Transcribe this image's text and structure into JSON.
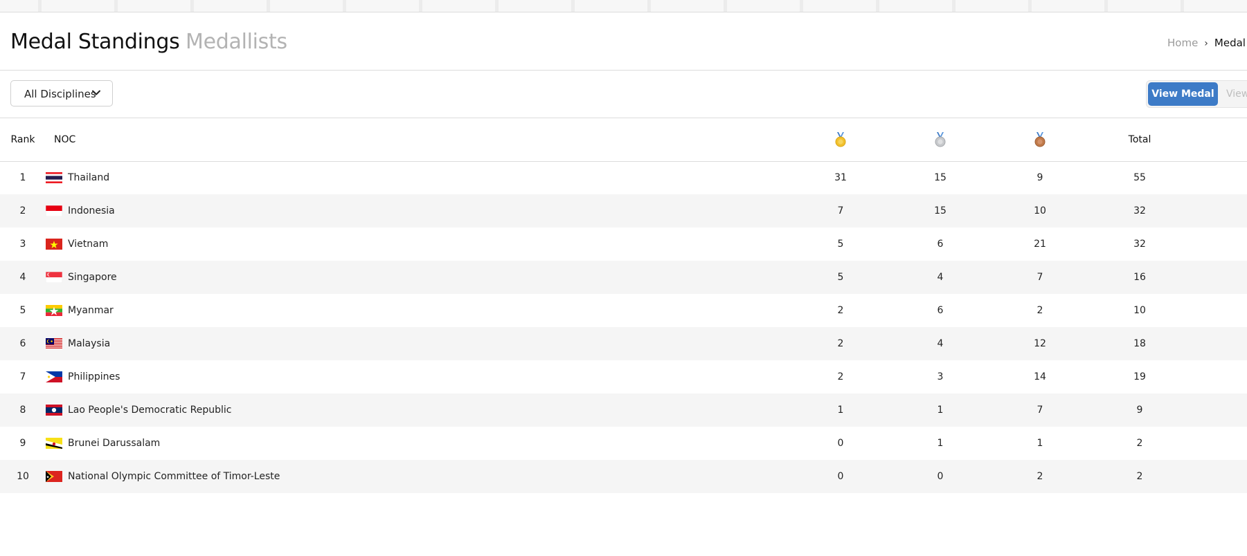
{
  "header": {
    "tab_active": "Medal Standings",
    "tab_inactive": "Medallists"
  },
  "breadcrumb": {
    "home": "Home",
    "current": "Medal S"
  },
  "filter": {
    "discipline_selected": "All Disciplines"
  },
  "view_toggle": {
    "active_label": "View Medal",
    "inactive_label": "View"
  },
  "table": {
    "headers": {
      "rank": "Rank",
      "noc": "NOC",
      "gold_icon": "gold-medal-icon",
      "silver_icon": "silver-medal-icon",
      "bronze_icon": "bronze-medal-icon",
      "total": "Total"
    },
    "rows": [
      {
        "rank": "1",
        "noc": "Thailand",
        "flag": "thailand-flag-icon",
        "gold": "31",
        "silver": "15",
        "bronze": "9",
        "total": "55"
      },
      {
        "rank": "2",
        "noc": "Indonesia",
        "flag": "indonesia-flag-icon",
        "gold": "7",
        "silver": "15",
        "bronze": "10",
        "total": "32"
      },
      {
        "rank": "3",
        "noc": "Vietnam",
        "flag": "vietnam-flag-icon",
        "gold": "5",
        "silver": "6",
        "bronze": "21",
        "total": "32"
      },
      {
        "rank": "4",
        "noc": "Singapore",
        "flag": "singapore-flag-icon",
        "gold": "5",
        "silver": "4",
        "bronze": "7",
        "total": "16"
      },
      {
        "rank": "5",
        "noc": "Myanmar",
        "flag": "myanmar-flag-icon",
        "gold": "2",
        "silver": "6",
        "bronze": "2",
        "total": "10"
      },
      {
        "rank": "6",
        "noc": "Malaysia",
        "flag": "malaysia-flag-icon",
        "gold": "2",
        "silver": "4",
        "bronze": "12",
        "total": "18"
      },
      {
        "rank": "7",
        "noc": "Philippines",
        "flag": "philippines-flag-icon",
        "gold": "2",
        "silver": "3",
        "bronze": "14",
        "total": "19"
      },
      {
        "rank": "8",
        "noc": "Lao People's Democratic Republic",
        "flag": "laos-flag-icon",
        "gold": "1",
        "silver": "1",
        "bronze": "7",
        "total": "9"
      },
      {
        "rank": "9",
        "noc": "Brunei Darussalam",
        "flag": "brunei-flag-icon",
        "gold": "0",
        "silver": "1",
        "bronze": "1",
        "total": "2"
      },
      {
        "rank": "10",
        "noc": "National Olympic Committee of Timor-Leste",
        "flag": "timor-leste-flag-icon",
        "gold": "0",
        "silver": "0",
        "bronze": "2",
        "total": "2"
      }
    ]
  },
  "colors": {
    "accent": "#3d7bc7",
    "gold": "#f2c12e",
    "silver": "#c7c9cc",
    "bronze": "#c07a4a",
    "row_alt": "#f5f5f5"
  }
}
